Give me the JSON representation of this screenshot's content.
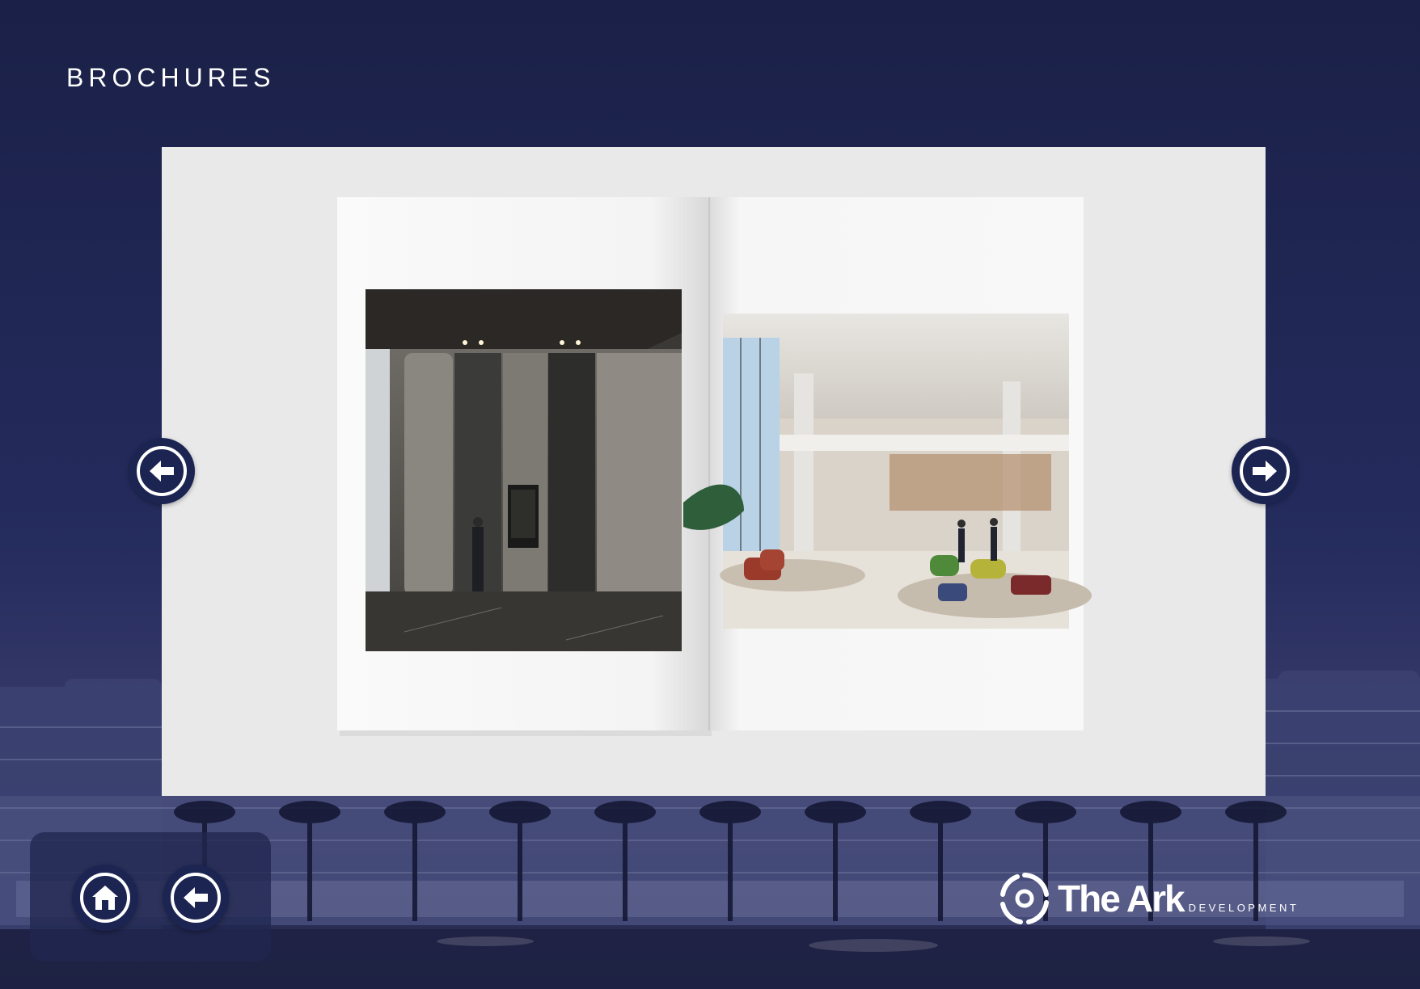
{
  "header": {
    "title": "BROCHURES"
  },
  "viewer": {
    "left_page_photo": "lift-lobby-render",
    "right_page_photo": "office-atrium-render",
    "prev_icon": "arrow-left-circle-icon",
    "next_icon": "arrow-right-circle-icon"
  },
  "bottom_nav": {
    "home_icon": "home-icon",
    "back_icon": "arrow-left-circle-icon"
  },
  "brand": {
    "name": "The Ark",
    "tagline": "DEVELOPMENT"
  },
  "colors": {
    "navy": "#1c2452",
    "background_top": "#1b2148",
    "viewer_bg": "#e9e9ea",
    "white": "#ffffff"
  }
}
